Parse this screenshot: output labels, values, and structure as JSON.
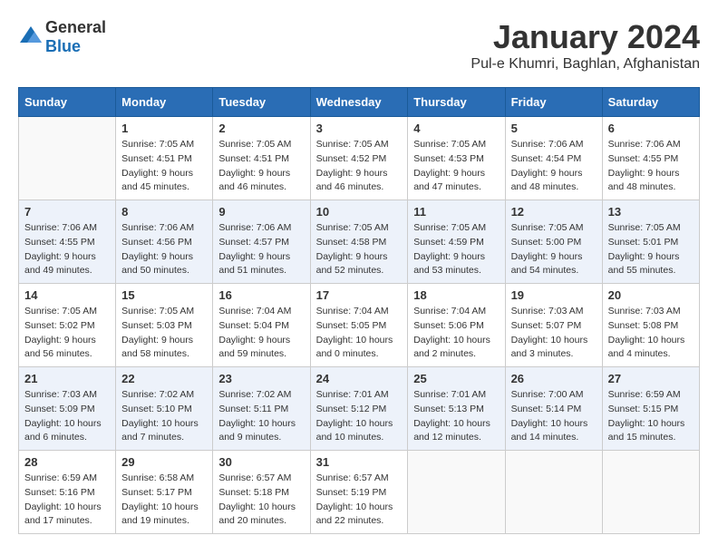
{
  "header": {
    "logo_general": "General",
    "logo_blue": "Blue",
    "month": "January 2024",
    "location": "Pul-e Khumri, Baghlan, Afghanistan"
  },
  "days_of_week": [
    "Sunday",
    "Monday",
    "Tuesday",
    "Wednesday",
    "Thursday",
    "Friday",
    "Saturday"
  ],
  "weeks": [
    [
      {
        "day": "",
        "sunrise": "",
        "sunset": "",
        "daylight": ""
      },
      {
        "day": "1",
        "sunrise": "Sunrise: 7:05 AM",
        "sunset": "Sunset: 4:51 PM",
        "daylight": "Daylight: 9 hours and 45 minutes."
      },
      {
        "day": "2",
        "sunrise": "Sunrise: 7:05 AM",
        "sunset": "Sunset: 4:51 PM",
        "daylight": "Daylight: 9 hours and 46 minutes."
      },
      {
        "day": "3",
        "sunrise": "Sunrise: 7:05 AM",
        "sunset": "Sunset: 4:52 PM",
        "daylight": "Daylight: 9 hours and 46 minutes."
      },
      {
        "day": "4",
        "sunrise": "Sunrise: 7:05 AM",
        "sunset": "Sunset: 4:53 PM",
        "daylight": "Daylight: 9 hours and 47 minutes."
      },
      {
        "day": "5",
        "sunrise": "Sunrise: 7:06 AM",
        "sunset": "Sunset: 4:54 PM",
        "daylight": "Daylight: 9 hours and 48 minutes."
      },
      {
        "day": "6",
        "sunrise": "Sunrise: 7:06 AM",
        "sunset": "Sunset: 4:55 PM",
        "daylight": "Daylight: 9 hours and 48 minutes."
      }
    ],
    [
      {
        "day": "7",
        "sunrise": "Sunrise: 7:06 AM",
        "sunset": "Sunset: 4:55 PM",
        "daylight": "Daylight: 9 hours and 49 minutes."
      },
      {
        "day": "8",
        "sunrise": "Sunrise: 7:06 AM",
        "sunset": "Sunset: 4:56 PM",
        "daylight": "Daylight: 9 hours and 50 minutes."
      },
      {
        "day": "9",
        "sunrise": "Sunrise: 7:06 AM",
        "sunset": "Sunset: 4:57 PM",
        "daylight": "Daylight: 9 hours and 51 minutes."
      },
      {
        "day": "10",
        "sunrise": "Sunrise: 7:05 AM",
        "sunset": "Sunset: 4:58 PM",
        "daylight": "Daylight: 9 hours and 52 minutes."
      },
      {
        "day": "11",
        "sunrise": "Sunrise: 7:05 AM",
        "sunset": "Sunset: 4:59 PM",
        "daylight": "Daylight: 9 hours and 53 minutes."
      },
      {
        "day": "12",
        "sunrise": "Sunrise: 7:05 AM",
        "sunset": "Sunset: 5:00 PM",
        "daylight": "Daylight: 9 hours and 54 minutes."
      },
      {
        "day": "13",
        "sunrise": "Sunrise: 7:05 AM",
        "sunset": "Sunset: 5:01 PM",
        "daylight": "Daylight: 9 hours and 55 minutes."
      }
    ],
    [
      {
        "day": "14",
        "sunrise": "Sunrise: 7:05 AM",
        "sunset": "Sunset: 5:02 PM",
        "daylight": "Daylight: 9 hours and 56 minutes."
      },
      {
        "day": "15",
        "sunrise": "Sunrise: 7:05 AM",
        "sunset": "Sunset: 5:03 PM",
        "daylight": "Daylight: 9 hours and 58 minutes."
      },
      {
        "day": "16",
        "sunrise": "Sunrise: 7:04 AM",
        "sunset": "Sunset: 5:04 PM",
        "daylight": "Daylight: 9 hours and 59 minutes."
      },
      {
        "day": "17",
        "sunrise": "Sunrise: 7:04 AM",
        "sunset": "Sunset: 5:05 PM",
        "daylight": "Daylight: 10 hours and 0 minutes."
      },
      {
        "day": "18",
        "sunrise": "Sunrise: 7:04 AM",
        "sunset": "Sunset: 5:06 PM",
        "daylight": "Daylight: 10 hours and 2 minutes."
      },
      {
        "day": "19",
        "sunrise": "Sunrise: 7:03 AM",
        "sunset": "Sunset: 5:07 PM",
        "daylight": "Daylight: 10 hours and 3 minutes."
      },
      {
        "day": "20",
        "sunrise": "Sunrise: 7:03 AM",
        "sunset": "Sunset: 5:08 PM",
        "daylight": "Daylight: 10 hours and 4 minutes."
      }
    ],
    [
      {
        "day": "21",
        "sunrise": "Sunrise: 7:03 AM",
        "sunset": "Sunset: 5:09 PM",
        "daylight": "Daylight: 10 hours and 6 minutes."
      },
      {
        "day": "22",
        "sunrise": "Sunrise: 7:02 AM",
        "sunset": "Sunset: 5:10 PM",
        "daylight": "Daylight: 10 hours and 7 minutes."
      },
      {
        "day": "23",
        "sunrise": "Sunrise: 7:02 AM",
        "sunset": "Sunset: 5:11 PM",
        "daylight": "Daylight: 10 hours and 9 minutes."
      },
      {
        "day": "24",
        "sunrise": "Sunrise: 7:01 AM",
        "sunset": "Sunset: 5:12 PM",
        "daylight": "Daylight: 10 hours and 10 minutes."
      },
      {
        "day": "25",
        "sunrise": "Sunrise: 7:01 AM",
        "sunset": "Sunset: 5:13 PM",
        "daylight": "Daylight: 10 hours and 12 minutes."
      },
      {
        "day": "26",
        "sunrise": "Sunrise: 7:00 AM",
        "sunset": "Sunset: 5:14 PM",
        "daylight": "Daylight: 10 hours and 14 minutes."
      },
      {
        "day": "27",
        "sunrise": "Sunrise: 6:59 AM",
        "sunset": "Sunset: 5:15 PM",
        "daylight": "Daylight: 10 hours and 15 minutes."
      }
    ],
    [
      {
        "day": "28",
        "sunrise": "Sunrise: 6:59 AM",
        "sunset": "Sunset: 5:16 PM",
        "daylight": "Daylight: 10 hours and 17 minutes."
      },
      {
        "day": "29",
        "sunrise": "Sunrise: 6:58 AM",
        "sunset": "Sunset: 5:17 PM",
        "daylight": "Daylight: 10 hours and 19 minutes."
      },
      {
        "day": "30",
        "sunrise": "Sunrise: 6:57 AM",
        "sunset": "Sunset: 5:18 PM",
        "daylight": "Daylight: 10 hours and 20 minutes."
      },
      {
        "day": "31",
        "sunrise": "Sunrise: 6:57 AM",
        "sunset": "Sunset: 5:19 PM",
        "daylight": "Daylight: 10 hours and 22 minutes."
      },
      {
        "day": "",
        "sunrise": "",
        "sunset": "",
        "daylight": ""
      },
      {
        "day": "",
        "sunrise": "",
        "sunset": "",
        "daylight": ""
      },
      {
        "day": "",
        "sunrise": "",
        "sunset": "",
        "daylight": ""
      }
    ]
  ]
}
